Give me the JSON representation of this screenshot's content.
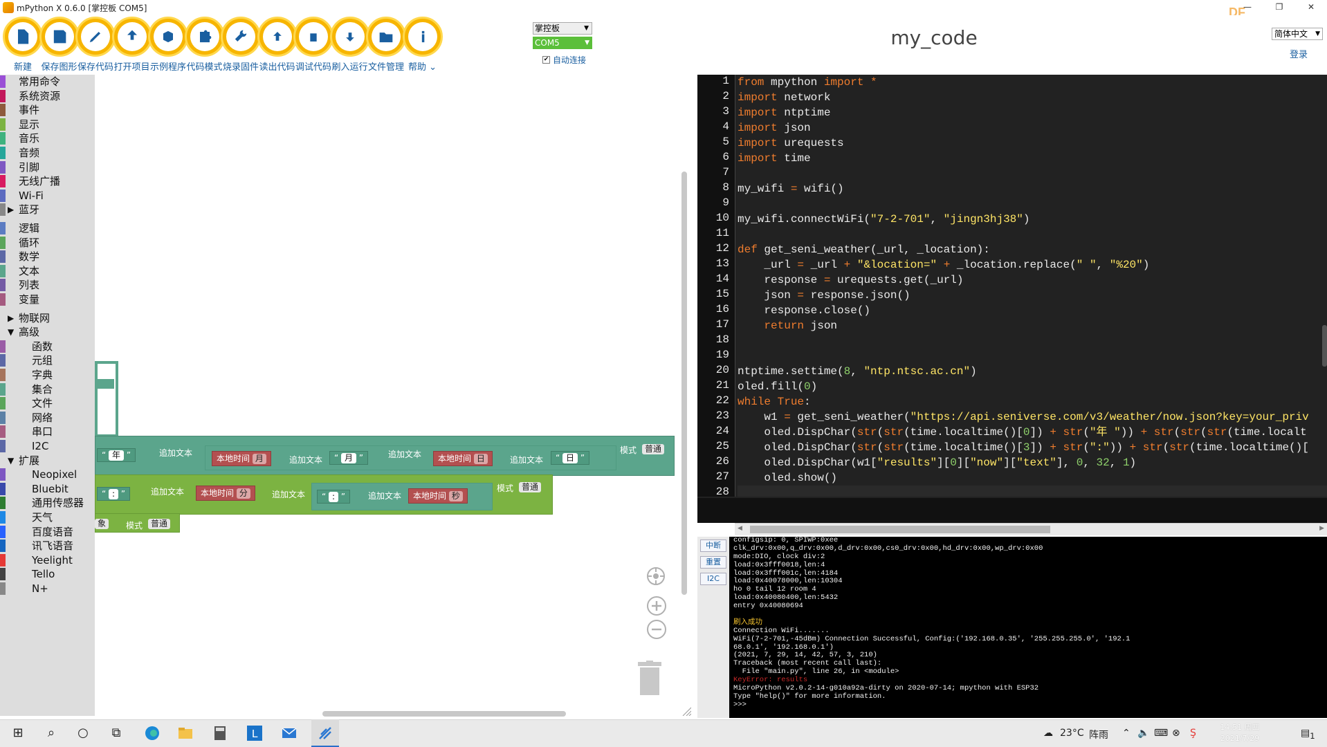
{
  "window": {
    "title": "mPython X 0.6.0 [掌控板 COM5]",
    "min": "—",
    "max": "❐",
    "close": "✕"
  },
  "toolbar": {
    "buttons": [
      {
        "label": "新建",
        "icon": "new-file-icon"
      },
      {
        "label": "保存图形",
        "icon": "save-icon"
      },
      {
        "label": "保存代码",
        "icon": "edit-icon"
      },
      {
        "label": "打开项目",
        "icon": "upload-icon"
      },
      {
        "label": "示例程序",
        "icon": "cubes-icon"
      },
      {
        "label": "代码模式",
        "icon": "puzzle-icon"
      },
      {
        "label": "烧录固件",
        "icon": "wrench-icon"
      },
      {
        "label": "读出代码",
        "icon": "arrow-up-circle-icon"
      },
      {
        "label": "调试代码",
        "icon": "bug-icon"
      },
      {
        "label": "刷入运行",
        "icon": "arrow-down-circle-icon"
      },
      {
        "label": "文件管理",
        "icon": "folder-icon"
      },
      {
        "label": "帮助",
        "icon": "info-icon"
      }
    ],
    "help_caret": "⌄",
    "device": "掌控板",
    "port": "COM5",
    "auto_connect": "自动连接",
    "auto_connect_checked": true,
    "check_mark": "✔",
    "dropdown_arrow": "▼"
  },
  "header": {
    "title": "my_code",
    "language": "简体中文",
    "login": "登录"
  },
  "brand": {
    "accent": "#f7b500",
    "link": "#1a5fa0"
  },
  "sidebar": {
    "categories": [
      {
        "label": "常用命令",
        "color": "#9a4fd6",
        "top": 0
      },
      {
        "label": "系统资源",
        "color": "#c2185b"
      },
      {
        "label": "事件",
        "color": "#8e5a3c"
      },
      {
        "label": "显示",
        "color": "#7cb342"
      },
      {
        "label": "音乐",
        "color": "#3fb27f"
      },
      {
        "label": "音频",
        "color": "#26a69a"
      },
      {
        "label": "引脚",
        "color": "#7e57c2"
      },
      {
        "label": "无线广播",
        "color": "#d81b60"
      },
      {
        "label": "Wi-Fi",
        "color": "#5c6bc0"
      },
      {
        "label": "蓝牙",
        "color": "#888888",
        "triangle": "▶"
      },
      {
        "label": "逻辑",
        "color": "#5c7cc2"
      },
      {
        "label": "循环",
        "color": "#5ba55b"
      },
      {
        "label": "数学",
        "color": "#5c68a6"
      },
      {
        "label": "文本",
        "color": "#5ba58c"
      },
      {
        "label": "列表",
        "color": "#745ba5"
      },
      {
        "label": "变量",
        "color": "#a55b80"
      },
      {
        "label": "物联网",
        "color": "#dddddd",
        "triangle": "▶"
      },
      {
        "label": "高级",
        "color": "#dddddd",
        "triangle": "▼"
      },
      {
        "label": "函数",
        "color": "#9a5ca6",
        "indent": true
      },
      {
        "label": "元组",
        "color": "#5c68a6",
        "indent": true
      },
      {
        "label": "字典",
        "color": "#a6745c",
        "indent": true
      },
      {
        "label": "集合",
        "color": "#5ba58c",
        "indent": true
      },
      {
        "label": "文件",
        "color": "#5ba55b",
        "indent": true
      },
      {
        "label": "网络",
        "color": "#5c81a6",
        "indent": true
      },
      {
        "label": "串口",
        "color": "#a65c81",
        "indent": true
      },
      {
        "label": "I2C",
        "color": "#5c68a6",
        "indent": true
      },
      {
        "label": "扩展",
        "color": "#dddddd",
        "triangle": "▼"
      },
      {
        "label": "Neopixel",
        "color": "#7e57c2",
        "indent": true
      },
      {
        "label": "Bluebit",
        "color": "#3949ab",
        "indent": true
      },
      {
        "label": "通用传感器",
        "color": "#2e7d32",
        "indent": true
      },
      {
        "label": "天气",
        "color": "#1e88e5",
        "indent": true
      },
      {
        "label": "百度语音",
        "color": "#2962ff",
        "indent": true
      },
      {
        "label": "讯飞语音",
        "color": "#1565c0",
        "indent": true
      },
      {
        "label": "Yeelight",
        "color": "#e53935",
        "indent": true
      },
      {
        "label": "Tello",
        "color": "#424242",
        "indent": true
      },
      {
        "label": "N+",
        "color": "#888888",
        "indent": true
      }
    ]
  },
  "blocks": {
    "quote_open": "“",
    "quote_close": "”",
    "year": "年",
    "month": "月",
    "day": "日",
    "append_text": "追加文本",
    "local_time": "本地时间",
    "field_month": "月",
    "field_day": "日",
    "field_min": "分",
    "field_sec": "秒",
    "colon": ":",
    "mode": "模式",
    "mode_val": "普通",
    "obj_suffix": "象"
  },
  "editor": {
    "lines": [
      [
        [
          "kw",
          "from"
        ],
        [
          "t",
          " mpython "
        ],
        [
          "kw",
          "import"
        ],
        [
          "t",
          " "
        ],
        [
          "kw",
          "*"
        ]
      ],
      [
        [
          "kw",
          "import"
        ],
        [
          "t",
          " network"
        ]
      ],
      [
        [
          "kw",
          "import"
        ],
        [
          "t",
          " ntptime"
        ]
      ],
      [
        [
          "kw",
          "import"
        ],
        [
          "t",
          " json"
        ]
      ],
      [
        [
          "kw",
          "import"
        ],
        [
          "t",
          " urequests"
        ]
      ],
      [
        [
          "kw",
          "import"
        ],
        [
          "t",
          " time"
        ]
      ],
      [],
      [
        [
          "t",
          "my_wifi "
        ],
        [
          "kw",
          "="
        ],
        [
          "t",
          " wifi()"
        ]
      ],
      [],
      [
        [
          "t",
          "my_wifi.connectWiFi("
        ],
        [
          "s",
          "\"7-2-701\""
        ],
        [
          "t",
          ", "
        ],
        [
          "s",
          "\"jingn3hj38\""
        ],
        [
          "t",
          ")"
        ]
      ],
      [],
      [
        [
          "kw",
          "def"
        ],
        [
          "t",
          " get_seni_weather(_url, _location):"
        ]
      ],
      [
        [
          "t",
          "    _url "
        ],
        [
          "kw",
          "="
        ],
        [
          "t",
          " _url "
        ],
        [
          "kw",
          "+"
        ],
        [
          "t",
          " "
        ],
        [
          "s",
          "\"&location=\""
        ],
        [
          "t",
          " "
        ],
        [
          "kw",
          "+"
        ],
        [
          "t",
          " _location.replace("
        ],
        [
          "s",
          "\" \""
        ],
        [
          "t",
          ", "
        ],
        [
          "s",
          "\"%20\""
        ],
        [
          "t",
          ")"
        ]
      ],
      [
        [
          "t",
          "    response "
        ],
        [
          "kw",
          "="
        ],
        [
          "t",
          " urequests.get(_url)"
        ]
      ],
      [
        [
          "t",
          "    json "
        ],
        [
          "kw",
          "="
        ],
        [
          "t",
          " response.json()"
        ]
      ],
      [
        [
          "t",
          "    response.close()"
        ]
      ],
      [
        [
          "t",
          "    "
        ],
        [
          "kw",
          "return"
        ],
        [
          "t",
          " json"
        ]
      ],
      [],
      [],
      [
        [
          "t",
          "ntptime.settime("
        ],
        [
          "n",
          "8"
        ],
        [
          "t",
          ", "
        ],
        [
          "s",
          "\"ntp.ntsc.ac.cn\""
        ],
        [
          "t",
          ")"
        ]
      ],
      [
        [
          "t",
          "oled.fill("
        ],
        [
          "n",
          "0"
        ],
        [
          "t",
          ")"
        ]
      ],
      [
        [
          "kw",
          "while"
        ],
        [
          "t",
          " "
        ],
        [
          "kw",
          "True"
        ],
        [
          "t",
          ":"
        ]
      ],
      [
        [
          "t",
          "    w1 "
        ],
        [
          "kw",
          "="
        ],
        [
          "t",
          " get_seni_weather("
        ],
        [
          "s",
          "\"https://api.seniverse.com/v3/weather/now.json?key=your_priv"
        ]
      ],
      [
        [
          "t",
          "    oled.DispChar("
        ],
        [
          "kw",
          "str"
        ],
        [
          "t",
          "("
        ],
        [
          "kw",
          "str"
        ],
        [
          "t",
          "(time.localtime()["
        ],
        [
          "n",
          "0"
        ],
        [
          "t",
          "]) "
        ],
        [
          "kw",
          "+"
        ],
        [
          "t",
          " "
        ],
        [
          "kw",
          "str"
        ],
        [
          "t",
          "("
        ],
        [
          "s",
          "\"年 \""
        ],
        [
          "t",
          ")) "
        ],
        [
          "kw",
          "+"
        ],
        [
          "t",
          " "
        ],
        [
          "kw",
          "str"
        ],
        [
          "t",
          "("
        ],
        [
          "kw",
          "str"
        ],
        [
          "t",
          "("
        ],
        [
          "kw",
          "str"
        ],
        [
          "t",
          "(time.localt"
        ]
      ],
      [
        [
          "t",
          "    oled.DispChar("
        ],
        [
          "kw",
          "str"
        ],
        [
          "t",
          "("
        ],
        [
          "kw",
          "str"
        ],
        [
          "t",
          "(time.localtime()["
        ],
        [
          "n",
          "3"
        ],
        [
          "t",
          "]) "
        ],
        [
          "kw",
          "+"
        ],
        [
          "t",
          " "
        ],
        [
          "kw",
          "str"
        ],
        [
          "t",
          "("
        ],
        [
          "s",
          "\":\""
        ],
        [
          "t",
          ")) "
        ],
        [
          "kw",
          "+"
        ],
        [
          "t",
          " "
        ],
        [
          "kw",
          "str"
        ],
        [
          "t",
          "("
        ],
        [
          "kw",
          "str"
        ],
        [
          "t",
          "(time.localtime()["
        ]
      ],
      [
        [
          "t",
          "    oled.DispChar(w1["
        ],
        [
          "s",
          "\"results\""
        ],
        [
          "t",
          "]["
        ],
        [
          "n",
          "0"
        ],
        [
          "t",
          "]["
        ],
        [
          "s",
          "\"now\""
        ],
        [
          "t",
          "]["
        ],
        [
          "s",
          "\"text\""
        ],
        [
          "t",
          "], "
        ],
        [
          "n",
          "0"
        ],
        [
          "t",
          ", "
        ],
        [
          "n",
          "32"
        ],
        [
          "t",
          ", "
        ],
        [
          "n",
          "1"
        ],
        [
          "t",
          ")"
        ]
      ],
      [
        [
          "t",
          "    oled.show()"
        ]
      ],
      []
    ]
  },
  "terminal": {
    "buttons": [
      "中断",
      "重置",
      "I2C"
    ],
    "lines": [
      {
        "t": "configsip: 0, SPIWP:0xee"
      },
      {
        "t": "clk_drv:0x00,q_drv:0x00,d_drv:0x00,cs0_drv:0x00,hd_drv:0x00,wp_drv:0x00"
      },
      {
        "t": "mode:DIO, clock div:2"
      },
      {
        "t": "load:0x3fff0018,len:4"
      },
      {
        "t": "load:0x3fff001c,len:4184"
      },
      {
        "t": "load:0x40078000,len:10304"
      },
      {
        "t": "ho 0 tail 12 room 4"
      },
      {
        "t": "load:0x40080400,len:5432"
      },
      {
        "t": "entry 0x40080694"
      },
      {
        "t": ""
      },
      {
        "t": "刷入成功",
        "c": "ok"
      },
      {
        "t": "Connection WiFi......."
      },
      {
        "t": "WiFi(7-2-701,-45dBm) Connection Successful, Config:('192.168.0.35', '255.255.255.0', '192.1"
      },
      {
        "t": "68.0.1', '192.168.0.1')"
      },
      {
        "t": "(2021, 7, 29, 14, 42, 57, 3, 210)"
      },
      {
        "t": "Traceback (most recent call last):"
      },
      {
        "t": "  File \"main.py\", line 26, in <module>"
      },
      {
        "t": "KeyError: results",
        "c": "err"
      },
      {
        "t": "MicroPython v2.0.2-14-g010a92a-dirty on 2020-07-14; mpython with ESP32"
      },
      {
        "t": "Type \"help()\" for more information."
      },
      {
        "t": ">>>"
      }
    ]
  },
  "taskbar": {
    "start_icon": "⊞",
    "search_icon": "⌕",
    "cortana_icon": "○",
    "taskview_icon": "⧉",
    "temp": "23°C",
    "weather": "阵雨",
    "time": "14:51 周四",
    "date": "2021/7/29",
    "notif": "1"
  }
}
